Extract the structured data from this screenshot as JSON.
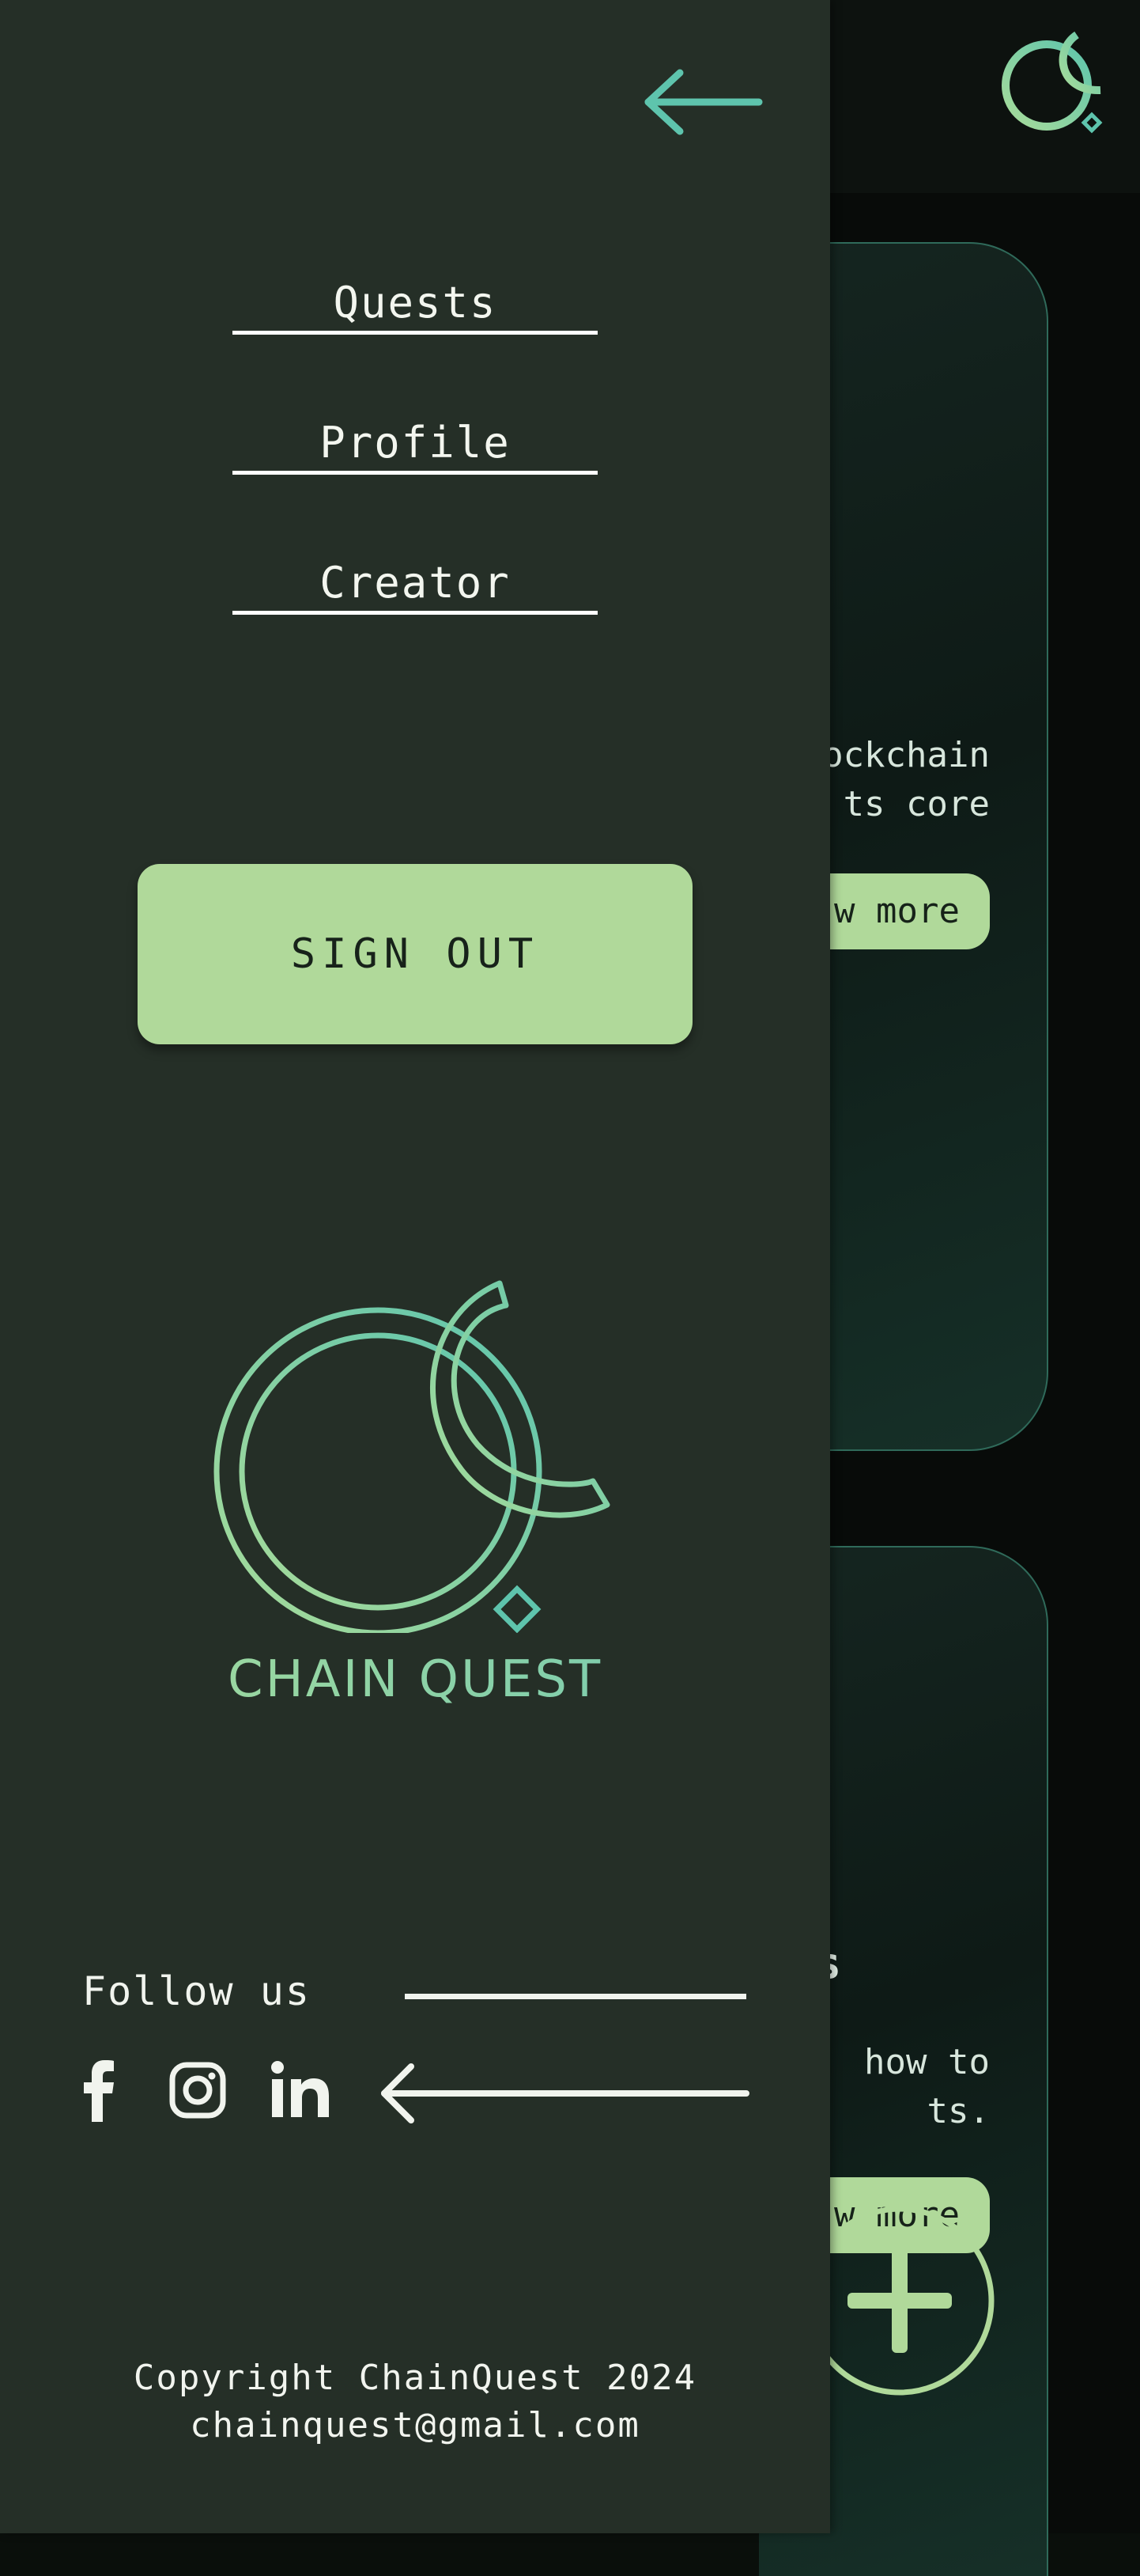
{
  "background_page": {
    "card1": {
      "text_line1": "ockchain",
      "text_line2": "ts  core",
      "button_label": "w more"
    },
    "card2": {
      "title_fragment": "s",
      "text_line1": " how  to",
      "text_line2": "ts.",
      "button_label": "w more"
    }
  },
  "drawer": {
    "nav": [
      {
        "label": "Quests"
      },
      {
        "label": "Profile"
      },
      {
        "label": "Creator"
      }
    ],
    "sign_out_label": "SIGN OUT",
    "brand_name": "CHAIN QUEST",
    "follow_label": "Follow us",
    "social_icons": [
      "facebook-icon",
      "instagram-icon",
      "linkedin-icon"
    ],
    "copyright_line1": "Copyright ChainQuest 2024",
    "copyright_line2": "chainquest@gmail.com"
  },
  "colors": {
    "drawer_bg": "#252f27",
    "accent_green": "#b0d99a",
    "accent_teal": "#5ec4ad",
    "text_light": "#f1f4ee"
  }
}
